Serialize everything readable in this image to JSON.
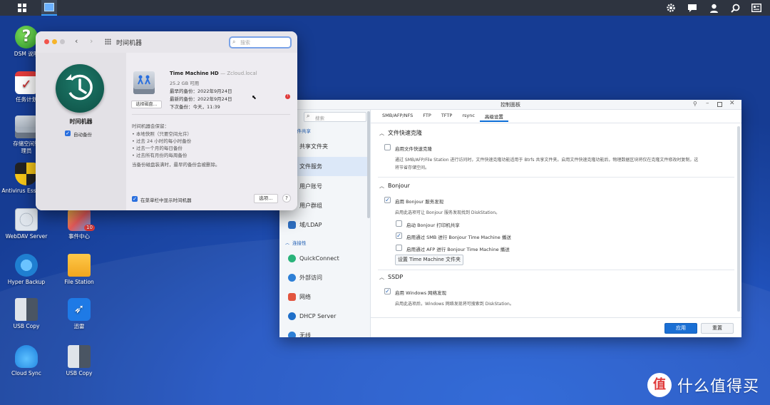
{
  "desktop": {
    "icons": [
      {
        "label": "DSM 说明"
      },
      {
        "label": "任务计划"
      },
      {
        "label": "存储空间管理员"
      },
      {
        "label": "Antivirus Essential"
      },
      {
        "label": "WebDAV Server"
      },
      {
        "label": "事件中心",
        "badge": "10"
      },
      {
        "label": "Hyper Backup"
      },
      {
        "label": "File Station"
      },
      {
        "label": "USB Copy"
      },
      {
        "label": "迅雷"
      },
      {
        "label": "Cloud Sync"
      },
      {
        "label": "USB Copy"
      }
    ]
  },
  "time_machine": {
    "title": "时间机器",
    "search_placeholder": "搜索",
    "app_name": "时间机器",
    "auto_backup": "自动备份",
    "disk_name": "Time Machine HD",
    "disk_host": "— Zcloud.local",
    "available": "25.2 GB 可用",
    "earliest": "最早的备份：2022年9月24日",
    "latest": "最新的备份：2022年9月24日",
    "next": "下次备份：今天，11:39",
    "select_disk": "选择磁盘…",
    "keeps_title": "时间机器会保留：",
    "keeps": [
      "• 本地快照（只要空间允许）",
      "• 过去 24 小时的每小时备份",
      "• 过去一个月的每日备份",
      "• 过去所有月份的每周备份"
    ],
    "note": "当备份磁盘装满时，最早的备份会被删除。",
    "menubar_option": "在菜单栏中显示时间机器",
    "options_button": "选项…",
    "help": "?"
  },
  "control_panel": {
    "title": "控制面板",
    "search_placeholder": "搜索",
    "side_group_1": "文件共享",
    "side_items": [
      "共享文件夹",
      "文件服务",
      "用户账号",
      "用户群组",
      "域/LDAP"
    ],
    "side_group_2": "连接性",
    "side_items_2": [
      "QuickConnect",
      "外部访问",
      "网络",
      "DHCP Server",
      "无线"
    ],
    "tabs": [
      "SMB/AFP/NFS",
      "FTP",
      "TFTP",
      "rsync",
      "高级设置"
    ],
    "sections": {
      "fast_clone": {
        "title": "文件快速克隆",
        "option": "启用文件快速克隆",
        "desc1": "通过 SMB/AFP/File Station 进行访问时，文件快速克隆功能适用于 Btrfs 共享文件夹。启用文件快速克隆功能后，物理数据区块将仅在克隆文件修改时复制，这",
        "desc2": "将节省存储空间。"
      },
      "bonjour": {
        "title": "Bonjour",
        "option": "启用 Bonjour 服务发现",
        "desc": "启用此选项可让 Bonjour 服务发现找到 DiskStation。",
        "printer": "启动 Bonjour 打印机共享",
        "smb": "启用通过 SMB 进行 Bonjour Time Machine 播送",
        "afp": "启用通过 AFP 进行 Bonjour Time Machine 播送",
        "set_button": "设置 Time Machine 文件夹"
      },
      "ssdp": {
        "title": "SSDP",
        "option": "启用 Windows 网络发现",
        "desc": "启用此选项后，Windows 网络发现将可搜索到 DiskStation。"
      }
    },
    "apply": "应用",
    "reset": "重置"
  },
  "watermark": "什么值得买",
  "colors": {
    "accent": "#0c6ed7",
    "apply_button": "#1a6fd4",
    "menubar": "#2e3440"
  }
}
